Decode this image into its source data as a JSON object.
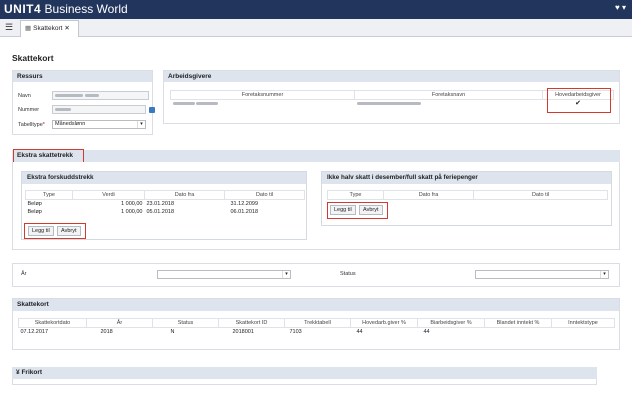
{
  "app": {
    "brand_bold": "UNIT4",
    "brand_rest": "Business World"
  },
  "tab": {
    "label": "Skattekort",
    "close": "✕"
  },
  "page_title": "Skattekort",
  "ressurs": {
    "title": "Ressurs",
    "navn_label": "Navn",
    "nummer_label": "Nummer",
    "tabelltype_label": "Tabelltype",
    "tabelltype_required": "*",
    "tabelltype_value": "Månedslønn"
  },
  "arbeidsgivere": {
    "title": "Arbeidsgivere",
    "columns": [
      "Foretaksnummer",
      "Foretaksnavn",
      "Hovedarbeidsgiver"
    ],
    "checked": true
  },
  "ekstra_skattetrekk": {
    "title": "Ekstra skattetrekk"
  },
  "ekstra_forskuddstrekk": {
    "title": "Ekstra forskuddstrekk",
    "columns": [
      "Type",
      "Verdi",
      "Dato fra",
      "Dato til"
    ],
    "rows": [
      [
        "Beløp",
        "1 000,00",
        "23.01.2018",
        "31.12.2099"
      ],
      [
        "Beløp",
        "1 000,00",
        "05.01.2018",
        "06.01.2018"
      ]
    ],
    "add_label": "Legg til",
    "cancel_label": "Avbryt"
  },
  "halv_skatt": {
    "title": "Ikke halv skatt i desember/full skatt på feriepenger",
    "columns": [
      "Type",
      "Dato fra",
      "Dato til"
    ],
    "add_label": "Legg til",
    "cancel_label": "Avbryt"
  },
  "filter": {
    "aar_label": "År",
    "status_label": "Status"
  },
  "skattekort": {
    "title": "Skattekort",
    "columns": [
      "Skattekortdato",
      "År",
      "Status",
      "Skattekort ID",
      "Trekktabell",
      "Hovedarb.giver %",
      "Biarbeidsgiver %",
      "Blandet inntekt %",
      "Inntektstype"
    ],
    "rows": [
      [
        "07.12.2017",
        "2018",
        "N",
        "2018001",
        "7103",
        "44",
        "44",
        "",
        ""
      ]
    ]
  },
  "frikort": {
    "title": "Frikort",
    "collapse": "¥"
  }
}
